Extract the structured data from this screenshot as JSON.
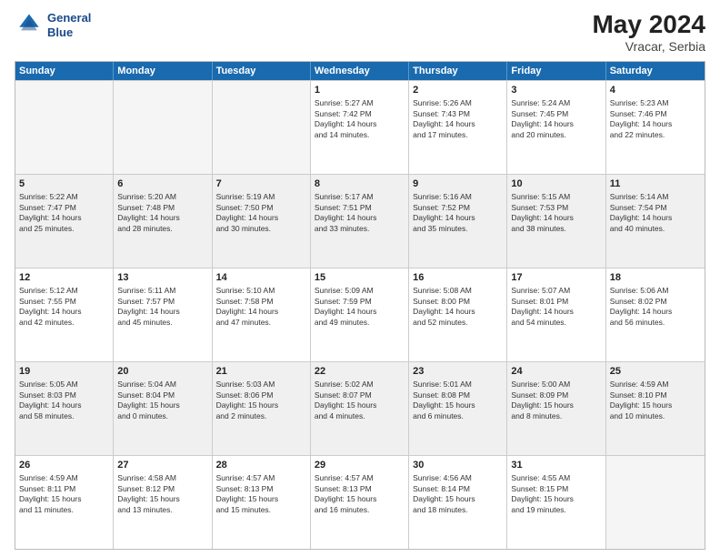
{
  "header": {
    "logo_line1": "General",
    "logo_line2": "Blue",
    "month_year": "May 2024",
    "location": "Vracar, Serbia"
  },
  "weekdays": [
    "Sunday",
    "Monday",
    "Tuesday",
    "Wednesday",
    "Thursday",
    "Friday",
    "Saturday"
  ],
  "rows": [
    [
      {
        "day": "",
        "text": "",
        "empty": true
      },
      {
        "day": "",
        "text": "",
        "empty": true
      },
      {
        "day": "",
        "text": "",
        "empty": true
      },
      {
        "day": "1",
        "text": "Sunrise: 5:27 AM\nSunset: 7:42 PM\nDaylight: 14 hours\nand 14 minutes."
      },
      {
        "day": "2",
        "text": "Sunrise: 5:26 AM\nSunset: 7:43 PM\nDaylight: 14 hours\nand 17 minutes."
      },
      {
        "day": "3",
        "text": "Sunrise: 5:24 AM\nSunset: 7:45 PM\nDaylight: 14 hours\nand 20 minutes."
      },
      {
        "day": "4",
        "text": "Sunrise: 5:23 AM\nSunset: 7:46 PM\nDaylight: 14 hours\nand 22 minutes."
      }
    ],
    [
      {
        "day": "5",
        "text": "Sunrise: 5:22 AM\nSunset: 7:47 PM\nDaylight: 14 hours\nand 25 minutes.",
        "shaded": true
      },
      {
        "day": "6",
        "text": "Sunrise: 5:20 AM\nSunset: 7:48 PM\nDaylight: 14 hours\nand 28 minutes.",
        "shaded": true
      },
      {
        "day": "7",
        "text": "Sunrise: 5:19 AM\nSunset: 7:50 PM\nDaylight: 14 hours\nand 30 minutes.",
        "shaded": true
      },
      {
        "day": "8",
        "text": "Sunrise: 5:17 AM\nSunset: 7:51 PM\nDaylight: 14 hours\nand 33 minutes.",
        "shaded": true
      },
      {
        "day": "9",
        "text": "Sunrise: 5:16 AM\nSunset: 7:52 PM\nDaylight: 14 hours\nand 35 minutes.",
        "shaded": true
      },
      {
        "day": "10",
        "text": "Sunrise: 5:15 AM\nSunset: 7:53 PM\nDaylight: 14 hours\nand 38 minutes.",
        "shaded": true
      },
      {
        "day": "11",
        "text": "Sunrise: 5:14 AM\nSunset: 7:54 PM\nDaylight: 14 hours\nand 40 minutes.",
        "shaded": true
      }
    ],
    [
      {
        "day": "12",
        "text": "Sunrise: 5:12 AM\nSunset: 7:55 PM\nDaylight: 14 hours\nand 42 minutes."
      },
      {
        "day": "13",
        "text": "Sunrise: 5:11 AM\nSunset: 7:57 PM\nDaylight: 14 hours\nand 45 minutes."
      },
      {
        "day": "14",
        "text": "Sunrise: 5:10 AM\nSunset: 7:58 PM\nDaylight: 14 hours\nand 47 minutes."
      },
      {
        "day": "15",
        "text": "Sunrise: 5:09 AM\nSunset: 7:59 PM\nDaylight: 14 hours\nand 49 minutes."
      },
      {
        "day": "16",
        "text": "Sunrise: 5:08 AM\nSunset: 8:00 PM\nDaylight: 14 hours\nand 52 minutes."
      },
      {
        "day": "17",
        "text": "Sunrise: 5:07 AM\nSunset: 8:01 PM\nDaylight: 14 hours\nand 54 minutes."
      },
      {
        "day": "18",
        "text": "Sunrise: 5:06 AM\nSunset: 8:02 PM\nDaylight: 14 hours\nand 56 minutes."
      }
    ],
    [
      {
        "day": "19",
        "text": "Sunrise: 5:05 AM\nSunset: 8:03 PM\nDaylight: 14 hours\nand 58 minutes.",
        "shaded": true
      },
      {
        "day": "20",
        "text": "Sunrise: 5:04 AM\nSunset: 8:04 PM\nDaylight: 15 hours\nand 0 minutes.",
        "shaded": true
      },
      {
        "day": "21",
        "text": "Sunrise: 5:03 AM\nSunset: 8:06 PM\nDaylight: 15 hours\nand 2 minutes.",
        "shaded": true
      },
      {
        "day": "22",
        "text": "Sunrise: 5:02 AM\nSunset: 8:07 PM\nDaylight: 15 hours\nand 4 minutes.",
        "shaded": true
      },
      {
        "day": "23",
        "text": "Sunrise: 5:01 AM\nSunset: 8:08 PM\nDaylight: 15 hours\nand 6 minutes.",
        "shaded": true
      },
      {
        "day": "24",
        "text": "Sunrise: 5:00 AM\nSunset: 8:09 PM\nDaylight: 15 hours\nand 8 minutes.",
        "shaded": true
      },
      {
        "day": "25",
        "text": "Sunrise: 4:59 AM\nSunset: 8:10 PM\nDaylight: 15 hours\nand 10 minutes.",
        "shaded": true
      }
    ],
    [
      {
        "day": "26",
        "text": "Sunrise: 4:59 AM\nSunset: 8:11 PM\nDaylight: 15 hours\nand 11 minutes."
      },
      {
        "day": "27",
        "text": "Sunrise: 4:58 AM\nSunset: 8:12 PM\nDaylight: 15 hours\nand 13 minutes."
      },
      {
        "day": "28",
        "text": "Sunrise: 4:57 AM\nSunset: 8:13 PM\nDaylight: 15 hours\nand 15 minutes."
      },
      {
        "day": "29",
        "text": "Sunrise: 4:57 AM\nSunset: 8:13 PM\nDaylight: 15 hours\nand 16 minutes."
      },
      {
        "day": "30",
        "text": "Sunrise: 4:56 AM\nSunset: 8:14 PM\nDaylight: 15 hours\nand 18 minutes."
      },
      {
        "day": "31",
        "text": "Sunrise: 4:55 AM\nSunset: 8:15 PM\nDaylight: 15 hours\nand 19 minutes."
      },
      {
        "day": "",
        "text": "",
        "empty": true
      }
    ]
  ]
}
